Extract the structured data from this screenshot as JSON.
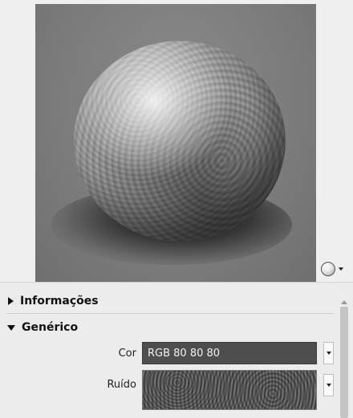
{
  "preview": {
    "mode_icon": "sphere-icon"
  },
  "sections": {
    "info_label": "Informações",
    "generic_label": "Genérico"
  },
  "fields": {
    "color_label": "Cor",
    "color_value": "RGB 80 80 80",
    "noise_label": "Ruído"
  },
  "colors": {
    "color_swatch": "#505050",
    "panel_bg": "#ececec"
  }
}
